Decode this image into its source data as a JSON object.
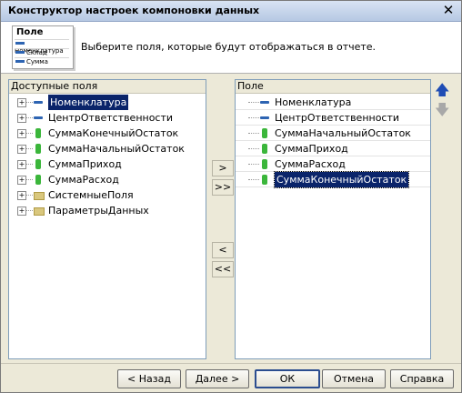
{
  "window": {
    "title": "Конструктор настроек компоновки данных"
  },
  "header": {
    "text": "Выберите поля, которые будут отображаться в отчете.",
    "logo": {
      "title": "Поле",
      "items": [
        "Номенклатура",
        "Склад",
        "Сумма"
      ]
    }
  },
  "left_panel": {
    "header": "Доступные поля",
    "items": [
      {
        "label": "Номенклатура",
        "icon": "dimension-icon",
        "selected": true
      },
      {
        "label": "ЦентрОтветственности",
        "icon": "dimension-icon"
      },
      {
        "label": "СуммаКонечныйОстаток",
        "icon": "resource-icon"
      },
      {
        "label": "СуммаНачальныйОстаток",
        "icon": "resource-icon"
      },
      {
        "label": "СуммаПриход",
        "icon": "resource-icon"
      },
      {
        "label": "СуммаРасход",
        "icon": "resource-icon"
      },
      {
        "label": "СистемныеПоля",
        "icon": "folder-icon"
      },
      {
        "label": "ПараметрыДанных",
        "icon": "folder-icon"
      }
    ]
  },
  "right_panel": {
    "header": "Поле",
    "items": [
      {
        "label": "Номенклатура",
        "icon": "dimension-icon"
      },
      {
        "label": "ЦентрОтветственности",
        "icon": "dimension-icon"
      },
      {
        "label": "СуммаНачальныйОстаток",
        "icon": "resource-icon"
      },
      {
        "label": "СуммаПриход",
        "icon": "resource-icon"
      },
      {
        "label": "СуммаРасход",
        "icon": "resource-icon"
      },
      {
        "label": "СуммаКонечныйОстаток",
        "icon": "resource-icon",
        "selected": true
      }
    ]
  },
  "middle_buttons": {
    "add": ">",
    "add_all": ">>",
    "remove": "<",
    "remove_all": "<<"
  },
  "footer": {
    "back": "< Назад",
    "next": "Далее >",
    "ok": "ОК",
    "cancel": "Отмена",
    "help": "Справка"
  },
  "colors": {
    "selection": "#0a246a",
    "dimension": "#2d64b2",
    "resource": "#3bb63b",
    "move_arrow": "#1f4db5"
  }
}
